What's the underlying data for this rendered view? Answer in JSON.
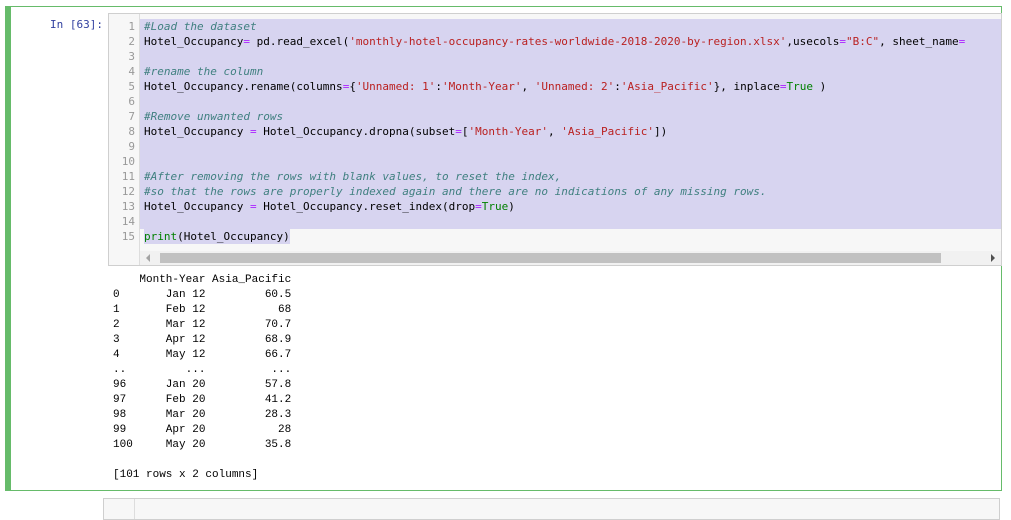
{
  "cell": {
    "prompt": "In [63]:",
    "code_lines": [
      {
        "n": "1",
        "tokens": [
          {
            "t": "#Load the dataset",
            "c": "cm"
          }
        ]
      },
      {
        "n": "2",
        "tokens": [
          {
            "t": "Hotel_Occupancy",
            "c": ""
          },
          {
            "t": "=",
            "c": "op"
          },
          {
            "t": " pd.read_excel(",
            "c": ""
          },
          {
            "t": "'monthly-hotel-occupancy-rates-worldwide-2018-2020-by-region.xlsx'",
            "c": "st"
          },
          {
            "t": ",usecols",
            "c": ""
          },
          {
            "t": "=",
            "c": "op"
          },
          {
            "t": "\"B:C\"",
            "c": "st"
          },
          {
            "t": ", sheet_name",
            "c": ""
          },
          {
            "t": "=",
            "c": "op"
          }
        ]
      },
      {
        "n": "3",
        "tokens": []
      },
      {
        "n": "4",
        "tokens": [
          {
            "t": "#rename the column",
            "c": "cm"
          }
        ]
      },
      {
        "n": "5",
        "tokens": [
          {
            "t": "Hotel_Occupancy.rename(columns",
            "c": ""
          },
          {
            "t": "=",
            "c": "op"
          },
          {
            "t": "{",
            "c": ""
          },
          {
            "t": "'Unnamed: 1'",
            "c": "st"
          },
          {
            "t": ":",
            "c": ""
          },
          {
            "t": "'Month-Year'",
            "c": "st"
          },
          {
            "t": ", ",
            "c": ""
          },
          {
            "t": "'Unnamed: 2'",
            "c": "st"
          },
          {
            "t": ":",
            "c": ""
          },
          {
            "t": "'Asia_Pacific'",
            "c": "st"
          },
          {
            "t": "}, inplace",
            "c": ""
          },
          {
            "t": "=",
            "c": "op"
          },
          {
            "t": "True",
            "c": "kw"
          },
          {
            "t": " )",
            "c": ""
          }
        ]
      },
      {
        "n": "6",
        "tokens": []
      },
      {
        "n": "7",
        "tokens": [
          {
            "t": "#Remove unwanted rows",
            "c": "cm"
          }
        ]
      },
      {
        "n": "8",
        "tokens": [
          {
            "t": "Hotel_Occupancy ",
            "c": ""
          },
          {
            "t": "=",
            "c": "op"
          },
          {
            "t": " Hotel_Occupancy.dropna(subset",
            "c": ""
          },
          {
            "t": "=",
            "c": "op"
          },
          {
            "t": "[",
            "c": ""
          },
          {
            "t": "'Month-Year'",
            "c": "st"
          },
          {
            "t": ", ",
            "c": ""
          },
          {
            "t": "'Asia_Pacific'",
            "c": "st"
          },
          {
            "t": "])",
            "c": ""
          }
        ]
      },
      {
        "n": "9",
        "tokens": []
      },
      {
        "n": "10",
        "tokens": []
      },
      {
        "n": "11",
        "tokens": [
          {
            "t": "#After removing the rows with blank values, to reset the index,",
            "c": "cm"
          }
        ]
      },
      {
        "n": "12",
        "tokens": [
          {
            "t": "#so that the rows are properly indexed again and there are no indications of any missing rows.",
            "c": "cm"
          }
        ]
      },
      {
        "n": "13",
        "tokens": [
          {
            "t": "Hotel_Occupancy ",
            "c": ""
          },
          {
            "t": "=",
            "c": "op"
          },
          {
            "t": " Hotel_Occupancy.reset_index(drop",
            "c": ""
          },
          {
            "t": "=",
            "c": "op"
          },
          {
            "t": "True",
            "c": "kw"
          },
          {
            "t": ")",
            "c": ""
          }
        ]
      },
      {
        "n": "14",
        "tokens": []
      },
      {
        "n": "15",
        "tokens": [
          {
            "t": "print",
            "c": "bi"
          },
          {
            "t": "(Hotel_Occupancy)",
            "c": ""
          }
        ]
      }
    ],
    "output": "    Month-Year Asia_Pacific\n0       Jan 12         60.5\n1       Feb 12           68\n2       Mar 12         70.7\n3       Apr 12         68.9\n4       May 12         66.7\n..         ...          ...\n96      Jan 20         57.8\n97      Feb 20         41.2\n98      Mar 20         28.3\n99      Apr 20           28\n100     May 20         35.8\n\n[101 rows x 2 columns]"
  },
  "colors": {
    "cell_border": "#66bb6a",
    "selection": "#d7d4f0",
    "comment": "#408080",
    "string": "#BA2121",
    "keyword": "#008000",
    "operator": "#AA22FF",
    "prompt": "#303f9f"
  }
}
